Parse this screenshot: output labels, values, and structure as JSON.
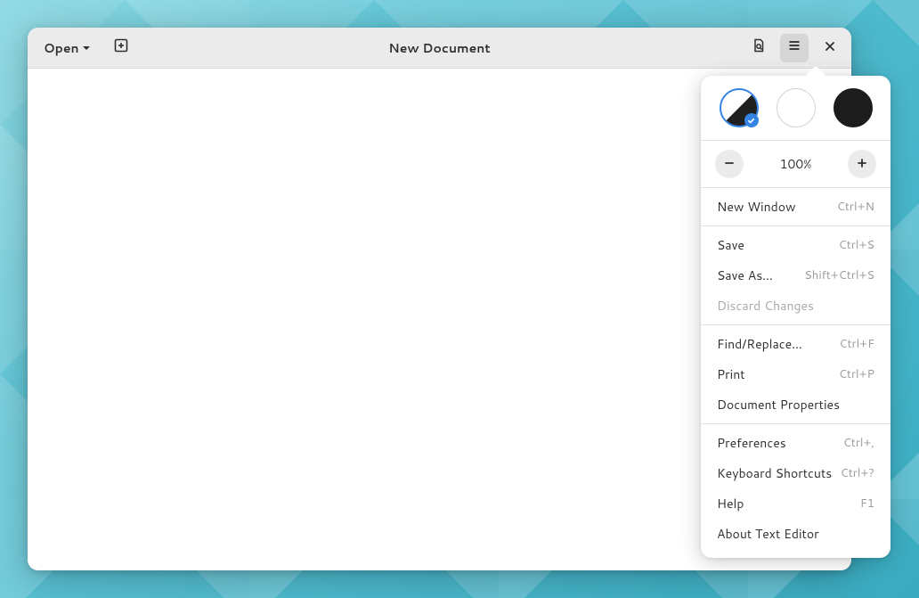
{
  "header": {
    "open_label": "Open",
    "title": "New Document"
  },
  "zoom": {
    "value": "100%"
  },
  "menu": {
    "sections": [
      [
        {
          "label": "New Window",
          "shortcut": "Ctrl+N",
          "disabled": false
        }
      ],
      [
        {
          "label": "Save",
          "shortcut": "Ctrl+S",
          "disabled": false
        },
        {
          "label": "Save As…",
          "shortcut": "Shift+Ctrl+S",
          "disabled": false
        },
        {
          "label": "Discard Changes",
          "shortcut": "",
          "disabled": true
        }
      ],
      [
        {
          "label": "Find/Replace…",
          "shortcut": "Ctrl+F",
          "disabled": false
        },
        {
          "label": "Print",
          "shortcut": "Ctrl+P",
          "disabled": false
        },
        {
          "label": "Document Properties",
          "shortcut": "",
          "disabled": false
        }
      ],
      [
        {
          "label": "Preferences",
          "shortcut": "Ctrl+,",
          "disabled": false
        },
        {
          "label": "Keyboard Shortcuts",
          "shortcut": "Ctrl+?",
          "disabled": false
        },
        {
          "label": "Help",
          "shortcut": "F1",
          "disabled": false
        },
        {
          "label": "About Text Editor",
          "shortcut": "",
          "disabled": false
        }
      ]
    ]
  }
}
